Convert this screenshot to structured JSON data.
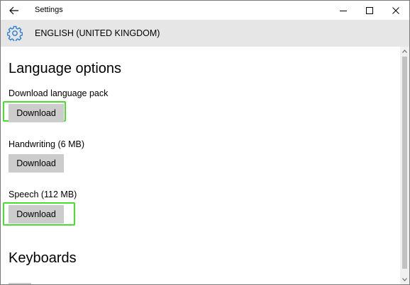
{
  "window": {
    "title": "Settings"
  },
  "header": {
    "title": "ENGLISH (UNITED KINGDOM)",
    "icon": "gear-icon"
  },
  "language_options": {
    "heading": "Language options",
    "language_pack": {
      "label": "Download language pack",
      "button": "Download"
    },
    "handwriting": {
      "label": "Handwriting (6 MB)",
      "button": "Download"
    },
    "speech": {
      "label": "Speech (112 MB)",
      "button": "Download"
    }
  },
  "keyboards": {
    "heading": "Keyboards"
  },
  "colors": {
    "highlight": "#47e02a",
    "button_bg": "#cccccc",
    "header_bg": "#e6e6e6"
  }
}
